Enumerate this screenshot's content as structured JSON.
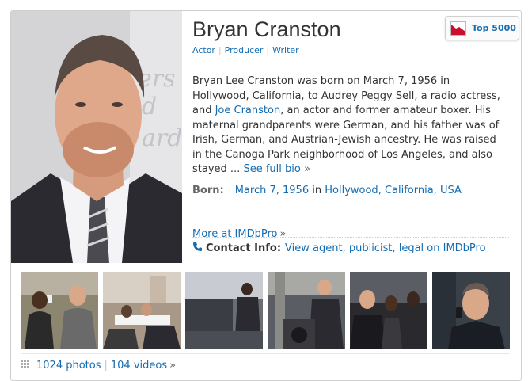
{
  "person": {
    "name": "Bryan Cranston",
    "roles": [
      "Actor",
      "Producer",
      "Writer"
    ]
  },
  "badge": {
    "label": "Top 5000",
    "icon": "trend-down-chart-icon"
  },
  "bio": {
    "lines": [
      "Bryan Lee Cranston was born on March 7, 1956 in",
      "Hollywood, California, to Audrey Peggy Sell, a radio actress,"
    ],
    "line3_before": "and ",
    "line3_link": "Joe Cranston",
    "line3_after": ", an actor and former amateur boxer. His",
    "lines_rest": [
      "maternal grandparents were German, and his father was of",
      "Irish, German, and Austrian-Jewish ancestry. He was raised",
      "in the Canoga Park neighborhood of Los Angeles, and also"
    ],
    "last_before": "stayed ... ",
    "see_full_bio": "See full bio",
    "arrow": "»"
  },
  "born": {
    "label": "Born:",
    "date": "March 7, 1956",
    "in_word": "in",
    "place": "Hollywood, California, USA"
  },
  "imdbpro": {
    "more_label": "More at IMDbPro",
    "arrow": "»",
    "contact_label": "Contact Info:",
    "contact_link": "View agent, publicist, legal on IMDbPro"
  },
  "media": {
    "photos": "1024 photos",
    "videos": "104 videos",
    "arrow": "»",
    "separator": "|"
  },
  "colors": {
    "link": "#136cb2",
    "badge_chart": "#c8102e"
  }
}
